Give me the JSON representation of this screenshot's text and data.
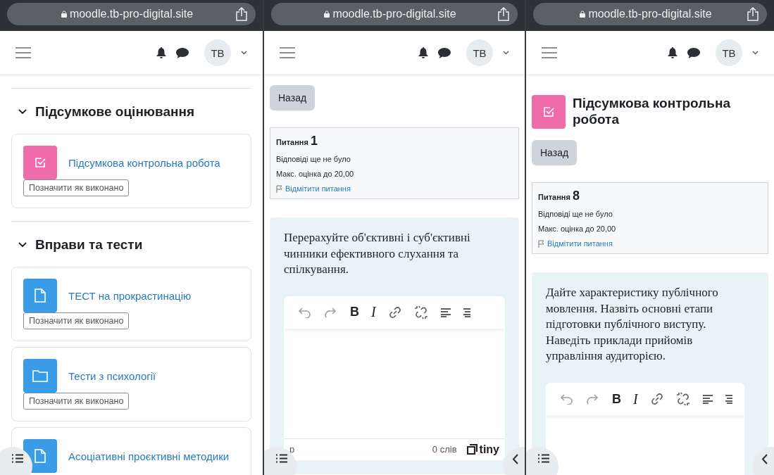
{
  "screens": [
    {
      "kind": "course",
      "url": "moodle.tb-pro-digital.site",
      "avatar": "TB",
      "sections": [
        {
          "title": "Підсумкове оцінювання",
          "expanded": true,
          "activities": [
            {
              "kind": "quiz",
              "name": "Підсумкова контрольна робота",
              "button": "Позначити як виконано"
            }
          ]
        },
        {
          "title": "Вправи та тести",
          "expanded": true,
          "activities": [
            {
              "kind": "page",
              "name": "ТЕСТ на прокрастинацію",
              "button": "Позначити як виконано"
            },
            {
              "kind": "folder",
              "name": "Тести з психології",
              "button": "Позначити як виконано"
            },
            {
              "kind": "page",
              "name": "Асоціативні проєктивні методики"
            }
          ]
        }
      ],
      "drawer_right": false
    },
    {
      "kind": "question",
      "url": "moodle.tb-pro-digital.site",
      "avatar": "TB",
      "back": "Назад",
      "question": {
        "label": "Питання",
        "number": "1",
        "status": "Відповіді ще не було",
        "mark": "Макс. оцінка до 20,00",
        "flag": "Відмітити питання",
        "text": "Перерахуйте об'єктивні і суб'єктивні чинники ефективного слухання та спілкування."
      },
      "editor": {
        "toolbar": [
          {
            "kind": "undo"
          },
          {
            "kind": "redo"
          },
          {
            "kind": "bold",
            "label": "B"
          },
          {
            "kind": "italic",
            "label": "I"
          },
          {
            "kind": "link"
          },
          {
            "kind": "unlink"
          },
          {
            "kind": "align-left"
          },
          {
            "kind": "align-center"
          }
        ],
        "path": "p",
        "word_count": "0 слів",
        "brand": "tiny"
      },
      "drawer_right": true
    },
    {
      "kind": "question",
      "url": "moodle.tb-pro-digital.site",
      "avatar": "TB",
      "heading": {
        "kind": "quiz",
        "title": "Підсумкова контрольна робота"
      },
      "back": "Назад",
      "question": {
        "label": "Питання",
        "number": "8",
        "status": "Відповіді ще не було",
        "mark": "Макс. оцінка до 20,00",
        "flag": "Відмітити питання",
        "text": "Дайте характеристику публічного мовлення. Назвіть основні етапи підготовки публічного виступу. Наведіть приклади прийомів управління аудиторією."
      },
      "editor": {
        "toolbar": [
          {
            "kind": "undo"
          },
          {
            "kind": "redo"
          },
          {
            "kind": "bold",
            "label": "B"
          },
          {
            "kind": "italic",
            "label": "I"
          },
          {
            "kind": "link"
          },
          {
            "kind": "unlink"
          },
          {
            "kind": "align-left"
          },
          {
            "kind": "align-center"
          }
        ]
      },
      "drawer_right": true
    }
  ]
}
